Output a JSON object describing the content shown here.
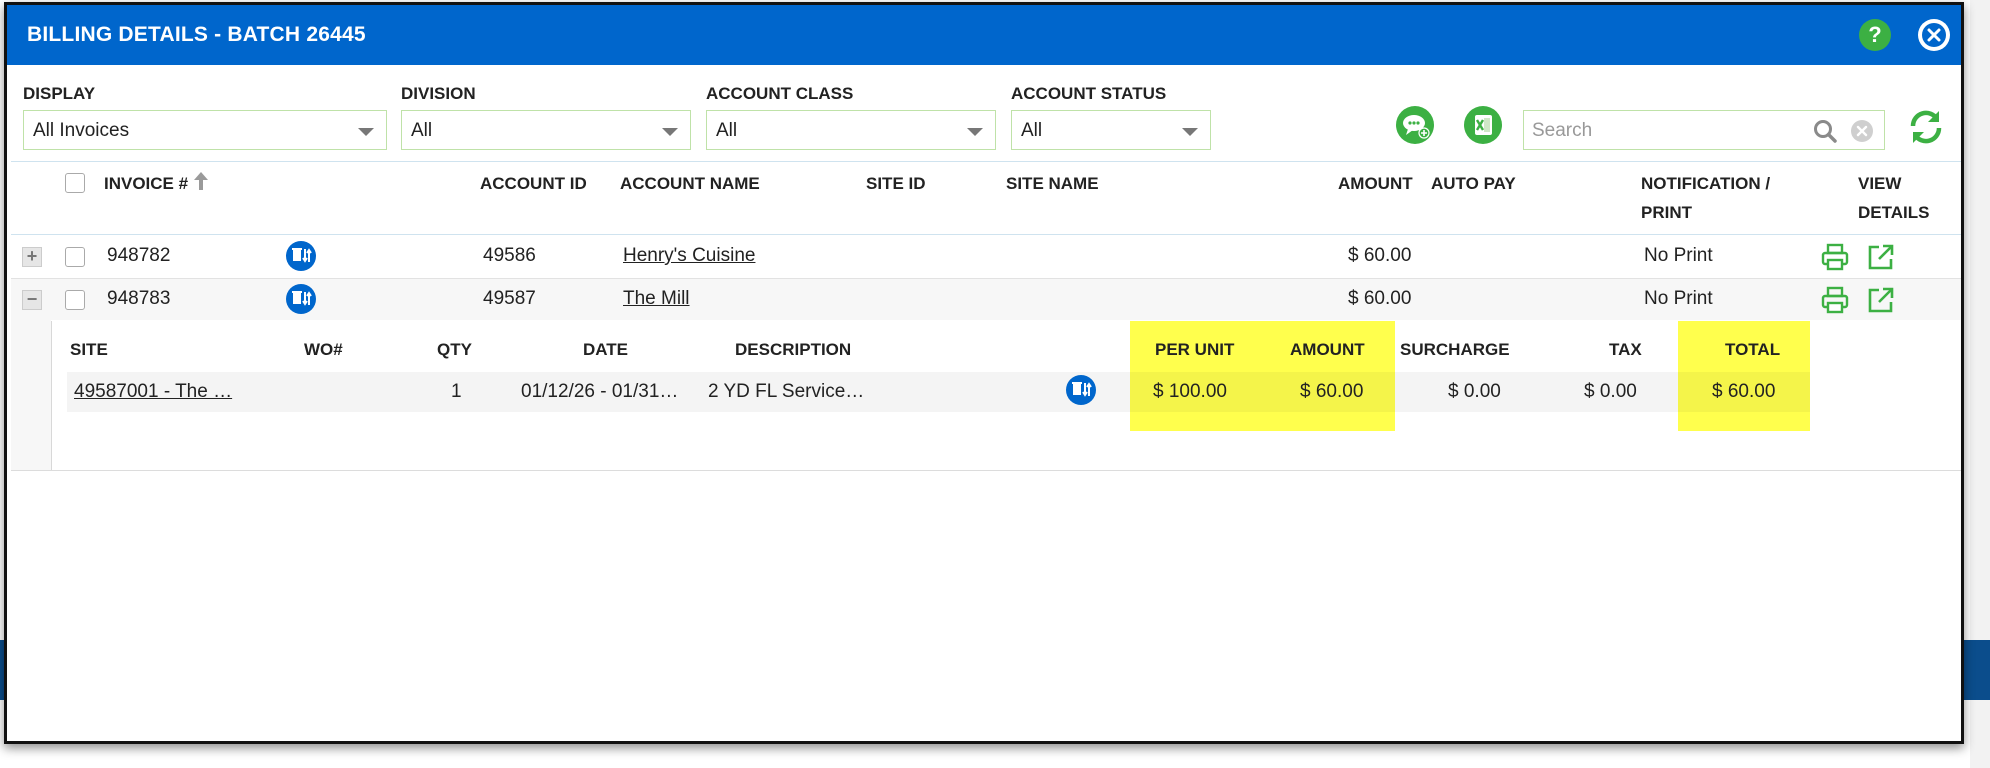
{
  "title": "BILLING DETAILS - BATCH 26445",
  "icons": {
    "help": "help-icon",
    "close": "close-icon",
    "add_note": "add-comment-icon",
    "excel": "excel-export-icon",
    "search": "search-icon",
    "clear": "clear-search-icon",
    "refresh": "refresh-icon",
    "print": "print-icon",
    "view": "open-external-icon",
    "service": "service-change-icon"
  },
  "help_glyph": "?",
  "filters": {
    "display": {
      "label": "DISPLAY",
      "value": "All Invoices"
    },
    "division": {
      "label": "DIVISION",
      "value": "All"
    },
    "account_class": {
      "label": "ACCOUNT CLASS",
      "value": "All"
    },
    "account_status": {
      "label": "ACCOUNT STATUS",
      "value": "All"
    }
  },
  "search": {
    "placeholder": "Search"
  },
  "columns": {
    "invoice": "INVOICE #",
    "account_id": "ACCOUNT ID",
    "account_name": "ACCOUNT NAME",
    "site_id": "SITE ID",
    "site_name": "SITE NAME",
    "amount": "AMOUNT",
    "auto_pay": "AUTO PAY",
    "notification_1": "NOTIFICATION /",
    "notification_2": "PRINT",
    "view_1": "VIEW",
    "view_2": "DETAILS"
  },
  "rows": [
    {
      "expander": "+",
      "invoice": "948782",
      "account_id": "49586",
      "account_name": "Henry's Cuisine",
      "site_id": "",
      "site_name": "",
      "amount": "$ 60.00",
      "auto_pay": "",
      "notification": "No Print"
    },
    {
      "expander": "−",
      "invoice": "948783",
      "account_id": "49587",
      "account_name": "The Mill",
      "site_id": "",
      "site_name": "",
      "amount": "$ 60.00",
      "auto_pay": "",
      "notification": "No Print"
    }
  ],
  "detail": {
    "columns": {
      "site": "SITE",
      "wo": "WO#",
      "qty": "QTY",
      "date": "DATE",
      "description": "DESCRIPTION",
      "per_unit": "PER UNIT",
      "amount": "AMOUNT",
      "surcharge": "SURCHARGE",
      "tax": "TAX",
      "total": "TOTAL"
    },
    "rows": [
      {
        "site": "49587001 - The …",
        "wo": "",
        "qty": "1",
        "date": "01/12/26 - 01/31…",
        "description": "2 YD FL Service…",
        "per_unit": "$ 100.00",
        "amount": "$ 60.00",
        "surcharge": "$ 0.00",
        "tax": "$ 0.00",
        "total": "$ 60.00"
      }
    ]
  },
  "colors": {
    "titlebar": "#0066cc",
    "accent_green": "#3cb043",
    "highlight": "#ffff4d",
    "service_icon": "#0066cc"
  }
}
